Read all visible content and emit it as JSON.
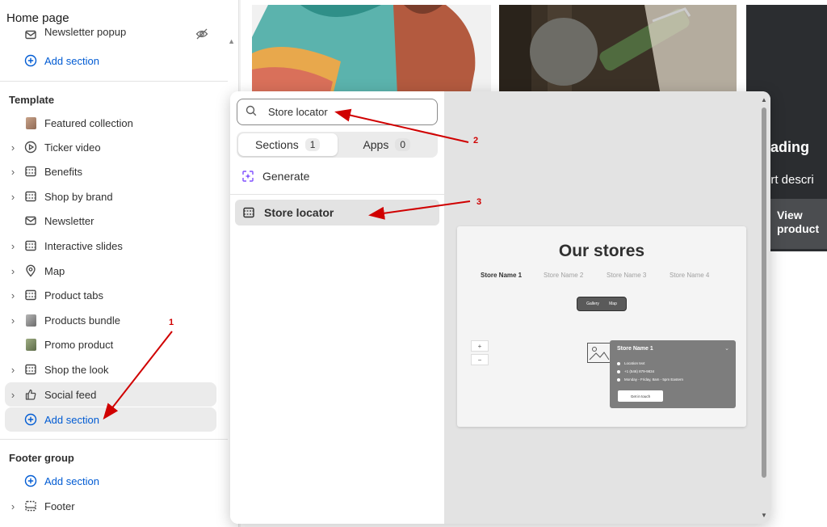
{
  "sidebar": {
    "title": "Home page",
    "header_items": [
      {
        "label": "Newsletter popup",
        "icon": "envelope-icon"
      },
      {
        "label": "Add section"
      }
    ],
    "template_label": "Template",
    "template_items": [
      {
        "label": "Featured collection",
        "icon": "image-thumb"
      },
      {
        "label": "Ticker video",
        "icon": "play-icon"
      },
      {
        "label": "Benefits",
        "icon": "section-icon"
      },
      {
        "label": "Shop by brand",
        "icon": "section-icon"
      },
      {
        "label": "Newsletter",
        "icon": "envelope-icon"
      },
      {
        "label": "Interactive slides",
        "icon": "section-icon"
      },
      {
        "label": "Map",
        "icon": "pin-icon"
      },
      {
        "label": "Product tabs",
        "icon": "section-icon"
      },
      {
        "label": "Products bundle",
        "icon": "image-thumb"
      },
      {
        "label": "Promo product",
        "icon": "image-thumb"
      },
      {
        "label": "Shop the look",
        "icon": "section-icon"
      },
      {
        "label": "Social feed",
        "icon": "thumbs-up-icon"
      }
    ],
    "template_add": "Add section",
    "footer_label": "Footer group",
    "footer_add": "Add section",
    "footer_item": {
      "label": "Footer",
      "icon": "section-icon"
    }
  },
  "popover": {
    "search_value": "Store locator",
    "tabs": [
      {
        "label": "Sections",
        "count": "1"
      },
      {
        "label": "Apps",
        "count": "0"
      }
    ],
    "generate_label": "Generate",
    "result_label": "Store locator",
    "preview": {
      "title": "Our stores",
      "store_tabs": [
        "Store Name 1",
        "Store Name 2",
        "Store Name 3",
        "Store Name 4"
      ],
      "toggle": [
        "Gallery",
        "Map"
      ],
      "card_name": "Store Name 1",
      "lines": [
        "Location text",
        "+1 (546) 879-9834",
        "Monday - Friday, 8am - 5pm Eastern"
      ],
      "cta": "Get in touch"
    }
  },
  "background_preview": {
    "heading": "eading",
    "subtext": "ort descri",
    "button": "View product"
  },
  "annotations": [
    "1",
    "2",
    "3"
  ],
  "colors": {
    "accent": "#005bd3",
    "annotation": "#d00000"
  }
}
